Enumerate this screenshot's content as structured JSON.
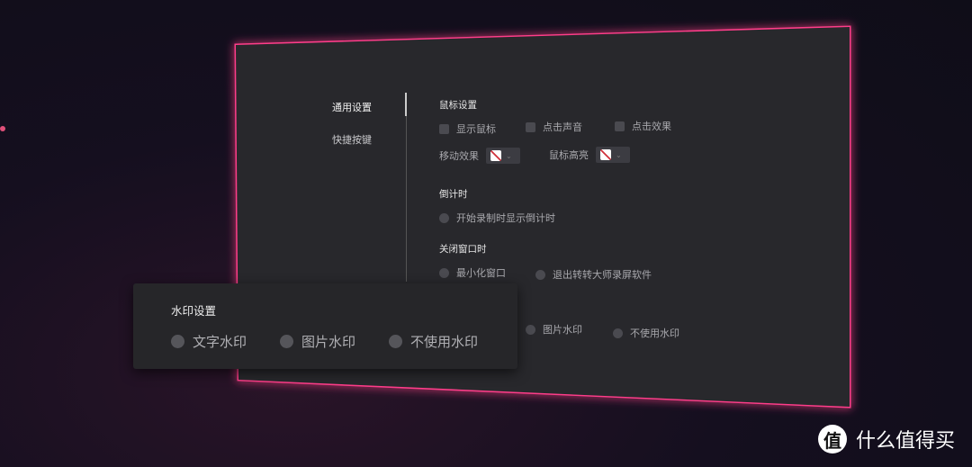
{
  "sidebar": {
    "items": [
      {
        "label": "通用设置",
        "active": true
      },
      {
        "label": "快捷按键",
        "active": false
      }
    ]
  },
  "mouse": {
    "title": "鼠标设置",
    "show_cursor": "显示鼠标",
    "click_sound": "点击声音",
    "click_effect": "点击效果",
    "move_effect": "移动效果",
    "cursor_highlight": "鼠标高亮"
  },
  "countdown": {
    "title": "倒计时",
    "option": "开始录制时显示倒计时"
  },
  "close_window": {
    "title": "关闭窗口时",
    "minimize": "最小化窗口",
    "exit": "退出转转大师录屏软件"
  },
  "watermark_behind": {
    "image": "图片水印",
    "none": "不使用水印"
  },
  "watermark_popup": {
    "title": "水印设置",
    "text": "文字水印",
    "image": "图片水印",
    "none": "不使用水印"
  },
  "logo": {
    "glyph": "值",
    "text": "什么值得买"
  },
  "colors": {
    "glow": "#ff3d8a",
    "panel": "#28282c",
    "popup": "#262629"
  }
}
